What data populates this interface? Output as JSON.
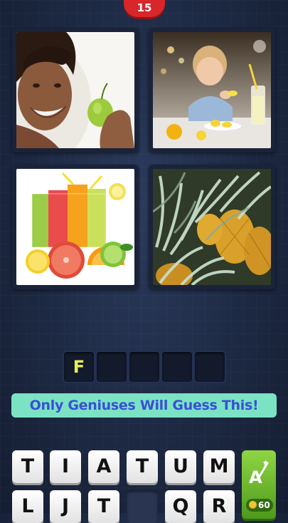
{
  "level": {
    "number": "15"
  },
  "images": [
    {
      "name": "woman-with-apple"
    },
    {
      "name": "child-with-lemonade"
    },
    {
      "name": "fruit-juices"
    },
    {
      "name": "pineapples"
    }
  ],
  "answer": {
    "slots": [
      "F",
      "",
      "",
      "",
      "",
      ""
    ]
  },
  "banner": {
    "text": "Only Geniuses Will Guess This!"
  },
  "keyboard": {
    "row1": [
      "T",
      "I",
      "A",
      "T",
      "U",
      "M"
    ],
    "row2": [
      "L",
      "J",
      "T",
      "",
      "Q",
      "R"
    ]
  },
  "hint": {
    "coins": "60"
  },
  "colors": {
    "banner_bg": "#7be3c4",
    "banner_text": "#3a4fd6",
    "hint_green": "#6ebb2e",
    "letter_yellow": "#e5f05a"
  }
}
